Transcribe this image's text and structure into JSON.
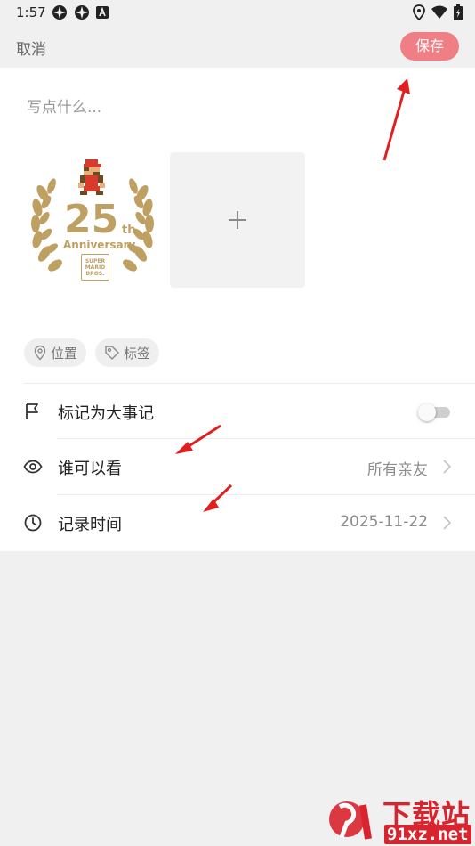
{
  "status_bar": {
    "time": "1:57",
    "left_icons": [
      "app-icon",
      "app-icon",
      "notification-a-icon"
    ],
    "right_icons": [
      "location-pin-icon",
      "wifi-icon",
      "battery-icon"
    ]
  },
  "top_bar": {
    "cancel_label": "取消",
    "save_label": "保存",
    "save_color": "#f07f85"
  },
  "note": {
    "placeholder": "写点什么...",
    "value": ""
  },
  "photos": {
    "items": [
      {
        "big_number": "25",
        "superscript": "th",
        "caption": "Anniversary",
        "badge_lines": [
          "SUPER",
          "MARIO",
          "BROS."
        ]
      }
    ],
    "add_icon": "plus-icon"
  },
  "chips": [
    {
      "icon": "location-pin-icon",
      "label": "位置"
    },
    {
      "icon": "tag-icon",
      "label": "标签"
    }
  ],
  "settings": [
    {
      "icon": "flag-icon",
      "label": "标记为大事记",
      "type": "toggle",
      "on": false
    },
    {
      "icon": "eye-icon",
      "label": "谁可以看",
      "value": "所有亲友",
      "type": "link"
    },
    {
      "icon": "clock-icon",
      "label": "记录时间",
      "value": "2025-11-22",
      "type": "link"
    }
  ],
  "watermark": {
    "title": "下载站",
    "site": "91xz.net",
    "color": "#d8242e"
  }
}
